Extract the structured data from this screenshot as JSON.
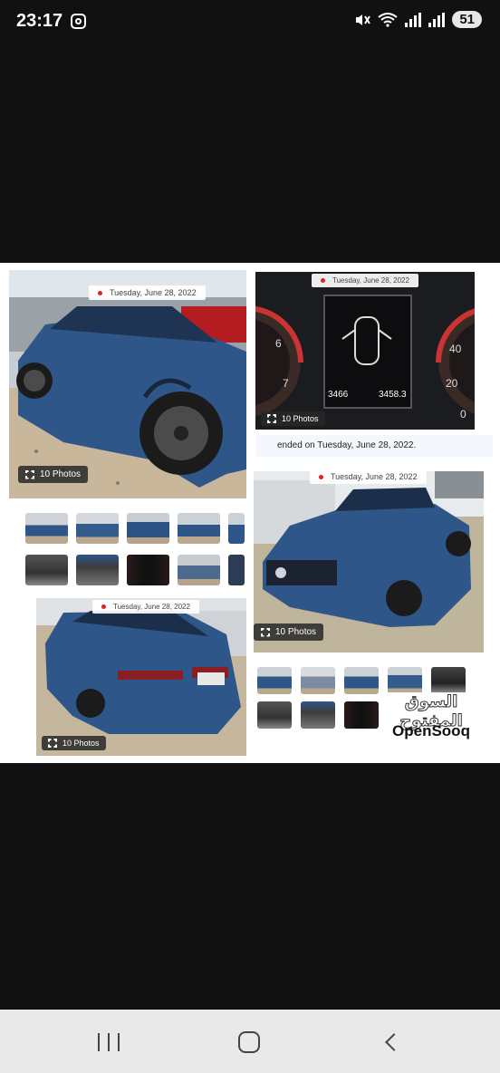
{
  "status_bar": {
    "time": "23:17",
    "battery": "51"
  },
  "listing_collage": {
    "panel_top_left": {
      "date": "Tuesday, June 28, 2022",
      "photos_count": "10 Photos"
    },
    "panel_top_right": {
      "date": "Tuesday, June 28, 2022",
      "photos_count": "10 Photos",
      "odometer_left": "3466",
      "odometer_right": "3458.3",
      "gauge_left_ticks": [
        "6",
        "7"
      ],
      "gauge_right_ticks": [
        "40",
        "20",
        "0"
      ]
    },
    "ended_text": "ended on Tuesday, June 28, 2022.",
    "panel_mid_right": {
      "date": "Tuesday, June 28, 2022",
      "photos_count": "10 Photos"
    },
    "panel_bottom_left": {
      "date": "Tuesday, June 28, 2022",
      "photos_count": "10 Photos"
    },
    "watermark": {
      "arabic": "السوق المفتوح",
      "latin": "OpenSooq"
    }
  },
  "colors": {
    "car_blue": "#2f5688",
    "background": "#111111",
    "nav_bar": "#e9e9ea"
  }
}
